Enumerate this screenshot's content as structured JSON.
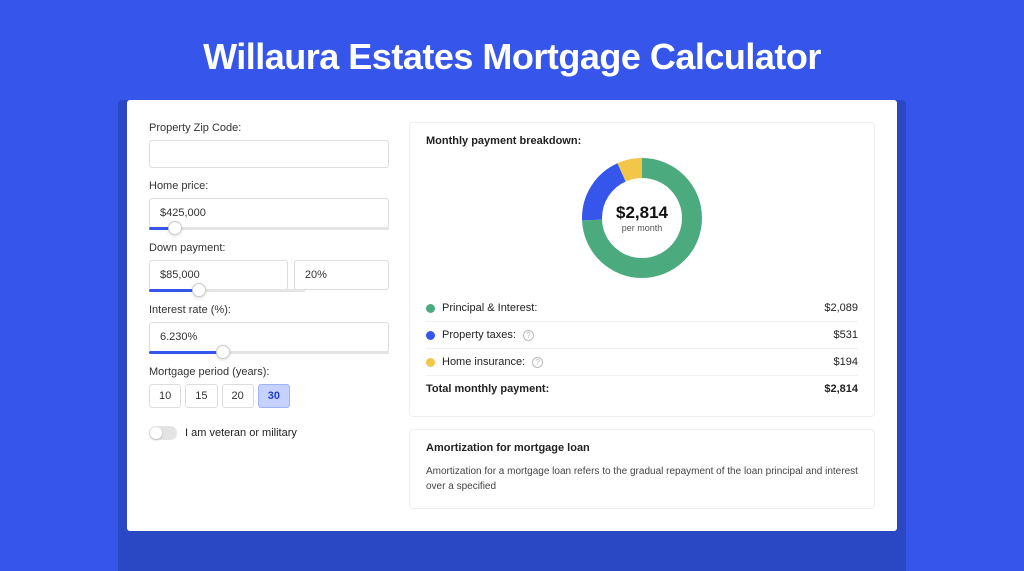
{
  "hero": {
    "title": "Willaura Estates Mortgage Calculator"
  },
  "form": {
    "zip_label": "Property Zip Code:",
    "zip_value": "",
    "home_price_label": "Home price:",
    "home_price_value": "$425,000",
    "down_payment_label": "Down payment:",
    "down_payment_value": "$85,000",
    "down_payment_pct": "20%",
    "interest_label": "Interest rate (%):",
    "interest_value": "6.230%",
    "period_label": "Mortgage period (years):",
    "periods": [
      "10",
      "15",
      "20",
      "30"
    ],
    "period_selected": "30",
    "veteran_label": "I am veteran or military"
  },
  "breakdown": {
    "title": "Monthly payment breakdown:",
    "center_amount": "$2,814",
    "center_sub": "per month",
    "items": [
      {
        "label": "Principal & Interest:",
        "value": "$2,089",
        "color": "#4bab7e",
        "info": false
      },
      {
        "label": "Property taxes:",
        "value": "$531",
        "color": "#3656eb",
        "info": true
      },
      {
        "label": "Home insurance:",
        "value": "$194",
        "color": "#f3c64a",
        "info": true
      }
    ],
    "total_label": "Total monthly payment:",
    "total_value": "$2,814"
  },
  "amort": {
    "title": "Amortization for mortgage loan",
    "body": "Amortization for a mortgage loan refers to the gradual repayment of the loan principal and interest over a specified"
  },
  "chart_data": {
    "type": "pie",
    "title": "Monthly payment breakdown",
    "series": [
      {
        "name": "Principal & Interest",
        "value": 2089,
        "color": "#4bab7e"
      },
      {
        "name": "Property taxes",
        "value": 531,
        "color": "#3656eb"
      },
      {
        "name": "Home insurance",
        "value": 194,
        "color": "#f3c64a"
      }
    ],
    "total": 2814,
    "center_label": "$2,814 per month"
  }
}
